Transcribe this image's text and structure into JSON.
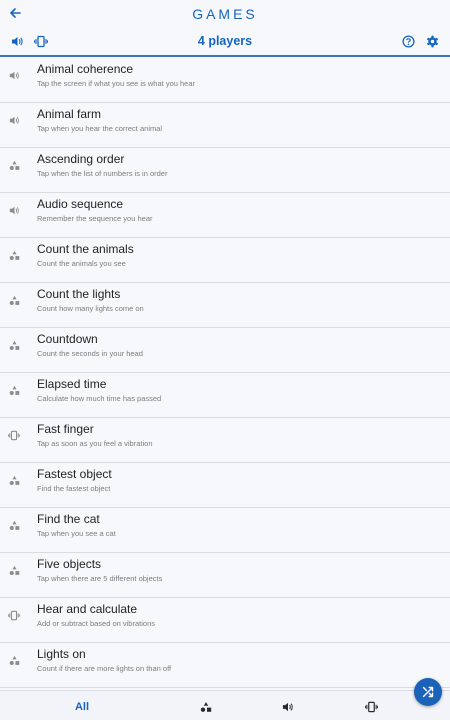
{
  "header": {
    "title": "GAMES",
    "players": "4 players",
    "back_icon": "arrow-left-icon",
    "sound_icon": "volume-icon",
    "vibrate_icon": "vibrate-icon",
    "help_icon": "help-circle-icon",
    "settings_icon": "gear-icon"
  },
  "colors": {
    "accent": "#1565c0",
    "background": "#f7f8fc",
    "divider": "#d9dce3",
    "fab": "#1a63b8"
  },
  "games": [
    {
      "name": "Animal coherence",
      "description": "Tap the screen if what you see is what you hear",
      "icon": "sound-icon"
    },
    {
      "name": "Animal farm",
      "description": "Tap when you hear the correct animal",
      "icon": "sound-icon"
    },
    {
      "name": "Ascending order",
      "description": "Tap when the list of numbers is in order",
      "icon": "shapes-icon"
    },
    {
      "name": "Audio sequence",
      "description": "Remember the sequence you hear",
      "icon": "sound-icon"
    },
    {
      "name": "Count the animals",
      "description": "Count the animals you see",
      "icon": "shapes-icon"
    },
    {
      "name": "Count the lights",
      "description": "Count how many lights come on",
      "icon": "shapes-icon"
    },
    {
      "name": "Countdown",
      "description": "Count the seconds in your head",
      "icon": "shapes-icon"
    },
    {
      "name": "Elapsed time",
      "description": "Calculate how much time has passed",
      "icon": "shapes-icon"
    },
    {
      "name": "Fast finger",
      "description": "Tap as soon as you feel a vibration",
      "icon": "vibrate-icon"
    },
    {
      "name": "Fastest object",
      "description": "Find the fastest object",
      "icon": "shapes-icon"
    },
    {
      "name": "Find the cat",
      "description": "Tap when you see a cat",
      "icon": "shapes-icon"
    },
    {
      "name": "Five objects",
      "description": "Tap when there are 5 different objects",
      "icon": "shapes-icon"
    },
    {
      "name": "Hear and calculate",
      "description": "Add or subtract based on vibrations",
      "icon": "vibrate-icon"
    },
    {
      "name": "Lights on",
      "description": "Count if there are more lights on than off",
      "icon": "shapes-icon"
    }
  ],
  "bottom_nav": {
    "all_label": "All",
    "items": [
      {
        "icon": "shapes-icon"
      },
      {
        "icon": "sound-icon"
      },
      {
        "icon": "vibrate-icon"
      }
    ]
  },
  "fab": {
    "icon": "shuffle-icon"
  }
}
